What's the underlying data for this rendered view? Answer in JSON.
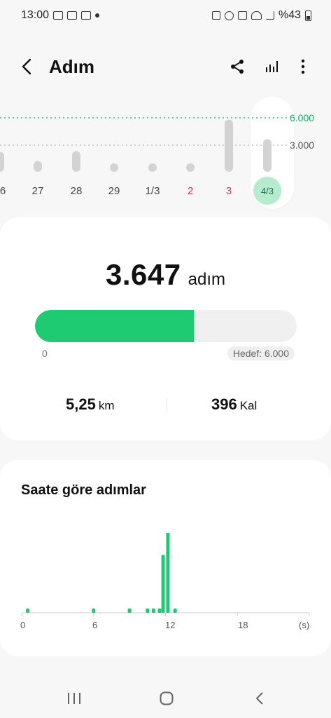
{
  "status": {
    "time": "13:00",
    "battery": "%43"
  },
  "appbar": {
    "title": "Adım"
  },
  "weekly_chart": {
    "y_labels": [
      "6.000",
      "3.000"
    ],
    "days": [
      {
        "label": "6",
        "value": 2200,
        "color": "normal"
      },
      {
        "label": "27",
        "value": 1200,
        "color": "normal"
      },
      {
        "label": "28",
        "value": 2300,
        "color": "normal"
      },
      {
        "label": "29",
        "value": 700,
        "color": "normal"
      },
      {
        "label": "1/3",
        "value": 900,
        "color": "normal"
      },
      {
        "label": "2",
        "value": 900,
        "color": "red"
      },
      {
        "label": "3",
        "value": 5800,
        "color": "red"
      },
      {
        "label": "4/3",
        "value": 3647,
        "color": "selected"
      }
    ]
  },
  "summary": {
    "steps": "3.647",
    "steps_unit": "adım",
    "progress_fraction": 0.608,
    "progress_start": "0",
    "goal_label": "Hedef: 6.000",
    "distance_value": "5,25",
    "distance_unit": "km",
    "calories_value": "396",
    "calories_unit": "Kal"
  },
  "hourly": {
    "title": "Saate göre adımlar",
    "x_labels": [
      "0",
      "6",
      "12",
      "18",
      "(s)"
    ],
    "accent": "#1ecb72"
  },
  "chart_data": {
    "type": "bar",
    "title": "Saate göre adımlar",
    "xlabel": "(s)",
    "x": [
      0.5,
      6,
      9,
      10.5,
      11,
      11.5,
      11.8,
      12.2,
      12.8
    ],
    "values": [
      80,
      80,
      80,
      80,
      80,
      80,
      1050,
      1450,
      80
    ],
    "xlim": [
      0,
      23
    ],
    "x_ticks": [
      0,
      6,
      12,
      18
    ],
    "series": [
      {
        "values": [
          80,
          80,
          80,
          80,
          80,
          80,
          1050,
          1450,
          80
        ]
      }
    ]
  }
}
